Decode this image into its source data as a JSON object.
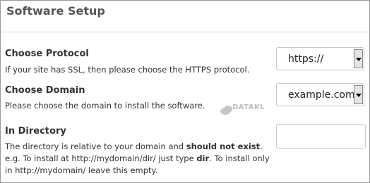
{
  "panel": {
    "title": "Software Setup"
  },
  "protocol": {
    "label": "Choose Protocol",
    "description": "If your site has SSL, then please choose the HTTPS protocol.",
    "selected": "https://"
  },
  "domain": {
    "label": "Choose Domain",
    "description": "Please choose the domain to install the software.",
    "selected": "example.com"
  },
  "directory": {
    "label": "In Directory",
    "desc_part1": "The directory is relative to your domain and ",
    "desc_bold1": "should not exist",
    "desc_part2": ". e.g. To install at http://mydomain/dir/ just type ",
    "desc_bold2": "dir",
    "desc_part3": ". To install only in http://mydomain/ leave this empty.",
    "value": ""
  },
  "watermark": {
    "text": "DATAKL"
  }
}
